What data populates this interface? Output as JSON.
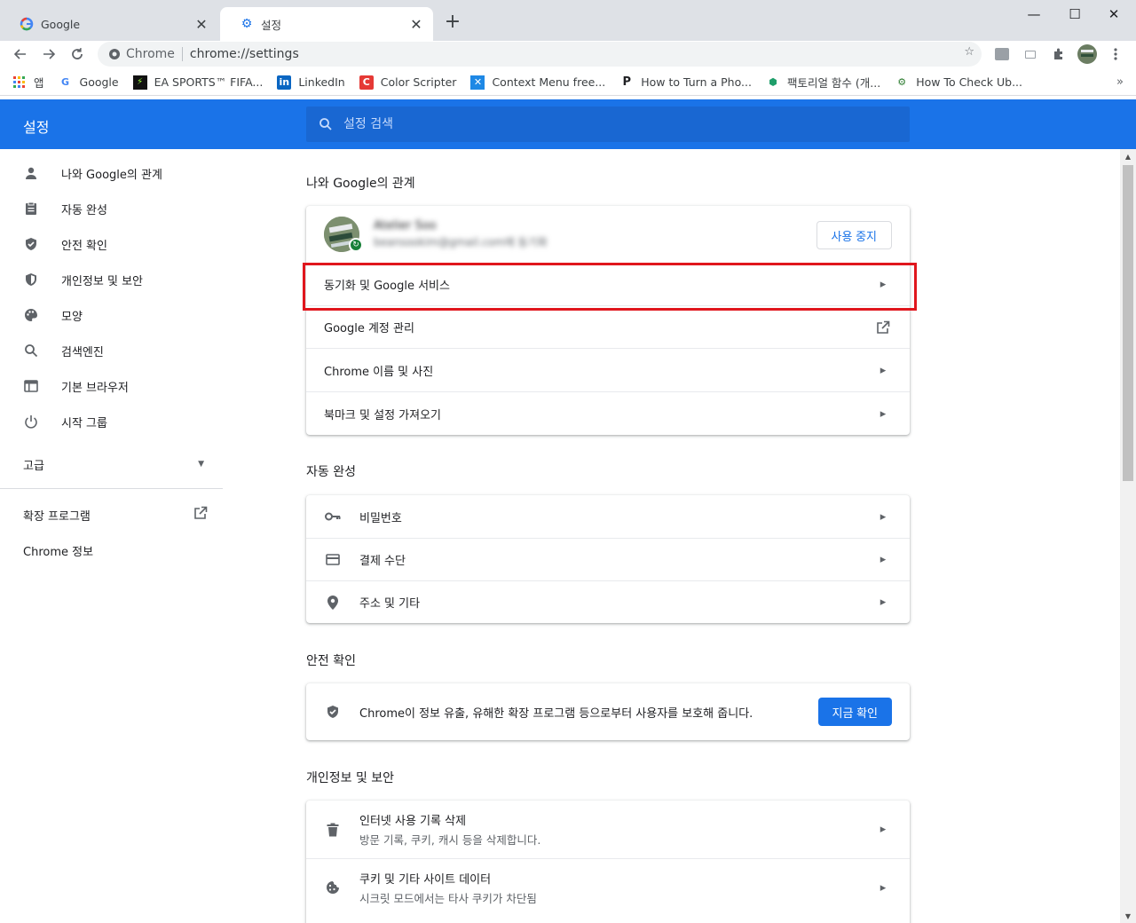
{
  "tabs": [
    {
      "title": "Google",
      "favicon": "G"
    },
    {
      "title": "설정",
      "favicon": "gear-icon"
    }
  ],
  "omnibox": {
    "site_label": "Chrome",
    "url": "chrome://settings"
  },
  "bookmarks": [
    {
      "label": "앱",
      "icon": "apps-grid-icon"
    },
    {
      "label": "Google",
      "icon": "G"
    },
    {
      "label": "EA SPORTS™ FIFA...",
      "icon": "ea-icon"
    },
    {
      "label": "LinkedIn",
      "icon": "in"
    },
    {
      "label": "Color Scripter",
      "icon": "C"
    },
    {
      "label": "Context Menu free...",
      "icon": "X"
    },
    {
      "label": "How to Turn a Pho...",
      "icon": "P"
    },
    {
      "label": "팩토리얼 함수 (개...",
      "icon": "shield-icon"
    },
    {
      "label": "How To Check Ub...",
      "icon": "gear-icon"
    }
  ],
  "header": {
    "title": "설정",
    "search_placeholder": "설정 검색"
  },
  "sidebar": {
    "items": [
      {
        "label": "나와 Google의 관계",
        "icon": "person-icon"
      },
      {
        "label": "자동 완성",
        "icon": "clipboard-icon"
      },
      {
        "label": "안전 확인",
        "icon": "shield-check-icon"
      },
      {
        "label": "개인정보 및 보안",
        "icon": "shield-half-icon"
      },
      {
        "label": "모양",
        "icon": "palette-icon"
      },
      {
        "label": "검색엔진",
        "icon": "search-icon"
      },
      {
        "label": "기본 브라우저",
        "icon": "browser-icon"
      },
      {
        "label": "시작 그룹",
        "icon": "power-icon"
      }
    ],
    "advanced": "고급",
    "extensions": "확장 프로그램",
    "about": "Chrome 정보"
  },
  "sections": {
    "you_google": {
      "title": "나와 Google의 관계",
      "profile_name": "Atelier Soo",
      "profile_email": "beansookim@gmail.com에 동기화",
      "stop_button": "사용 중지",
      "rows": [
        "동기화 및 Google 서비스",
        "Google 계정 관리",
        "Chrome 이름 및 사진",
        "북마크 및 설정 가져오기"
      ]
    },
    "autofill": {
      "title": "자동 완성",
      "rows": [
        "비밀번호",
        "결제 수단",
        "주소 및 기타"
      ]
    },
    "safety": {
      "title": "안전 확인",
      "text": "Chrome이 정보 유출, 유해한 확장 프로그램 등으로부터 사용자를 보호해 줍니다.",
      "button": "지금 확인"
    },
    "privacy": {
      "title": "개인정보 및 보안",
      "rows": [
        {
          "label": "인터넷 사용 기록 삭제",
          "sub": "방문 기록, 쿠키, 캐시 등을 삭제합니다."
        },
        {
          "label": "쿠키 및 기타 사이트 데이터",
          "sub": "시크릿 모드에서는 타사 쿠키가 차단됨"
        }
      ]
    }
  },
  "colors": {
    "accent": "#1a73e8",
    "highlight": "#e0161d"
  }
}
